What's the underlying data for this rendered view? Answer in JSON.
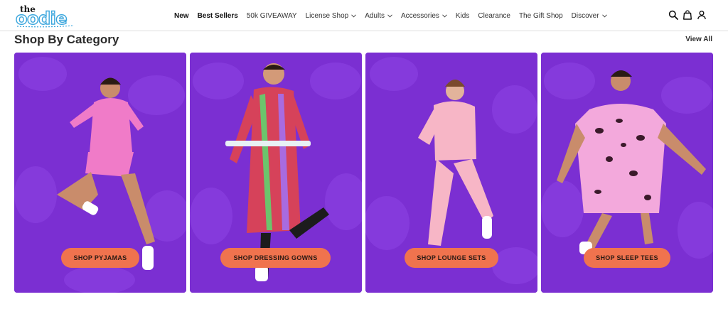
{
  "brand": {
    "logo_top": "the",
    "logo_main": "oodie",
    "accent": "#3aa6dd"
  },
  "nav": {
    "items": [
      {
        "label": "New",
        "bold": true,
        "dropdown": false
      },
      {
        "label": "Best Sellers",
        "bold": true,
        "dropdown": false
      },
      {
        "label": "50k GIVEAWAY",
        "bold": false,
        "dropdown": false
      },
      {
        "label": "License Shop",
        "bold": false,
        "dropdown": true
      },
      {
        "label": "Adults",
        "bold": false,
        "dropdown": true
      },
      {
        "label": "Accessories",
        "bold": false,
        "dropdown": true
      },
      {
        "label": "Kids",
        "bold": false,
        "dropdown": false
      },
      {
        "label": "Clearance",
        "bold": false,
        "dropdown": false
      },
      {
        "label": "The Gift Shop",
        "bold": false,
        "dropdown": false
      },
      {
        "label": "Discover",
        "bold": false,
        "dropdown": true
      }
    ],
    "icons": [
      "search-icon",
      "cart-icon",
      "account-icon"
    ]
  },
  "section": {
    "title": "Shop By Category",
    "view_all": "View All"
  },
  "cards": [
    {
      "button": "SHOP PYJAMAS",
      "garment_color": "#f07bc8",
      "figure": "woman jumping in pink pyjamas"
    },
    {
      "button": "SHOP DRESSING GOWNS",
      "garment_color": "#d6425a",
      "figure": "man in striped dressing gown"
    },
    {
      "button": "SHOP LOUNGE SETS",
      "garment_color": "#f7b6c6",
      "figure": "woman in pink lounge set"
    },
    {
      "button": "SHOP SLEEP TEES",
      "garment_color": "#f3a9dc",
      "figure": "woman in leopard sleep tee"
    }
  ],
  "colors": {
    "card_bg": "#7b2fd2",
    "button": "#f0734e"
  }
}
